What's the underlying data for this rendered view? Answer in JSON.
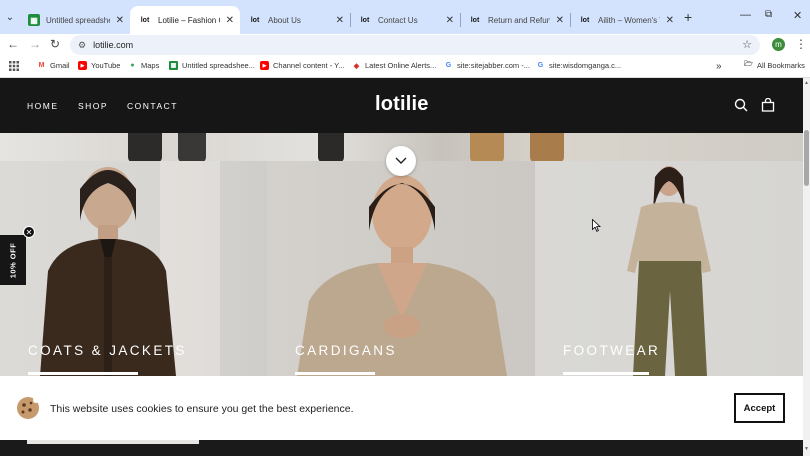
{
  "browser": {
    "tabs": [
      {
        "title": "Untitled spreadsheet",
        "favicon": "sheets-icon",
        "active": false
      },
      {
        "title": "Lotilie – Fashion Online",
        "favicon": "lot",
        "active": true
      },
      {
        "title": "About Us",
        "favicon": "lot",
        "active": false
      },
      {
        "title": "Contact Us",
        "favicon": "lot",
        "active": false
      },
      {
        "title": "Return and Refund Policy",
        "favicon": "lot",
        "active": false
      },
      {
        "title": "Ailith – Women's Tall",
        "favicon": "lot",
        "active": false
      }
    ],
    "favicon_text": "lot",
    "url": "lotilie.com",
    "profile_initial": "m",
    "bookmarks": [
      {
        "label": "Gmail",
        "icon": "gmail-icon",
        "color": "#ea4335"
      },
      {
        "label": "YouTube",
        "icon": "youtube-icon",
        "color": "#ff0000"
      },
      {
        "label": "Maps",
        "icon": "maps-pin-icon",
        "color": "#34a853"
      },
      {
        "label": "Untitled spreadshee...",
        "icon": "sheets-icon",
        "color": "#1e8e3e"
      },
      {
        "label": "Channel content - Y...",
        "icon": "youtube-icon",
        "color": "#ff0000"
      },
      {
        "label": "Latest Online Alerts...",
        "icon": "alerts-icon",
        "color": "#d93025"
      },
      {
        "label": "site:sitejabber.com -...",
        "icon": "google-icon",
        "color": "#4285f4"
      },
      {
        "label": "site:wisdomganga.c...",
        "icon": "google-icon",
        "color": "#4285f4"
      }
    ],
    "all_bookmarks": "All Bookmarks"
  },
  "site": {
    "nav": {
      "home": "HOME",
      "shop": "SHOP",
      "contact": "CONTACT"
    },
    "logo": "lotilie",
    "categories": [
      {
        "label": "COATS & JACKETS"
      },
      {
        "label": "CARDIGANS"
      },
      {
        "label": "FOOTWEAR"
      }
    ],
    "discount_tab": "10% OFF",
    "cookie": {
      "message": "This website uses cookies to ensure you get the best experience.",
      "accept": "Accept"
    }
  },
  "colors": {
    "header_bg": "#161616",
    "tab_strip": "#d3e3fd",
    "omnibox": "#edf2fa"
  }
}
